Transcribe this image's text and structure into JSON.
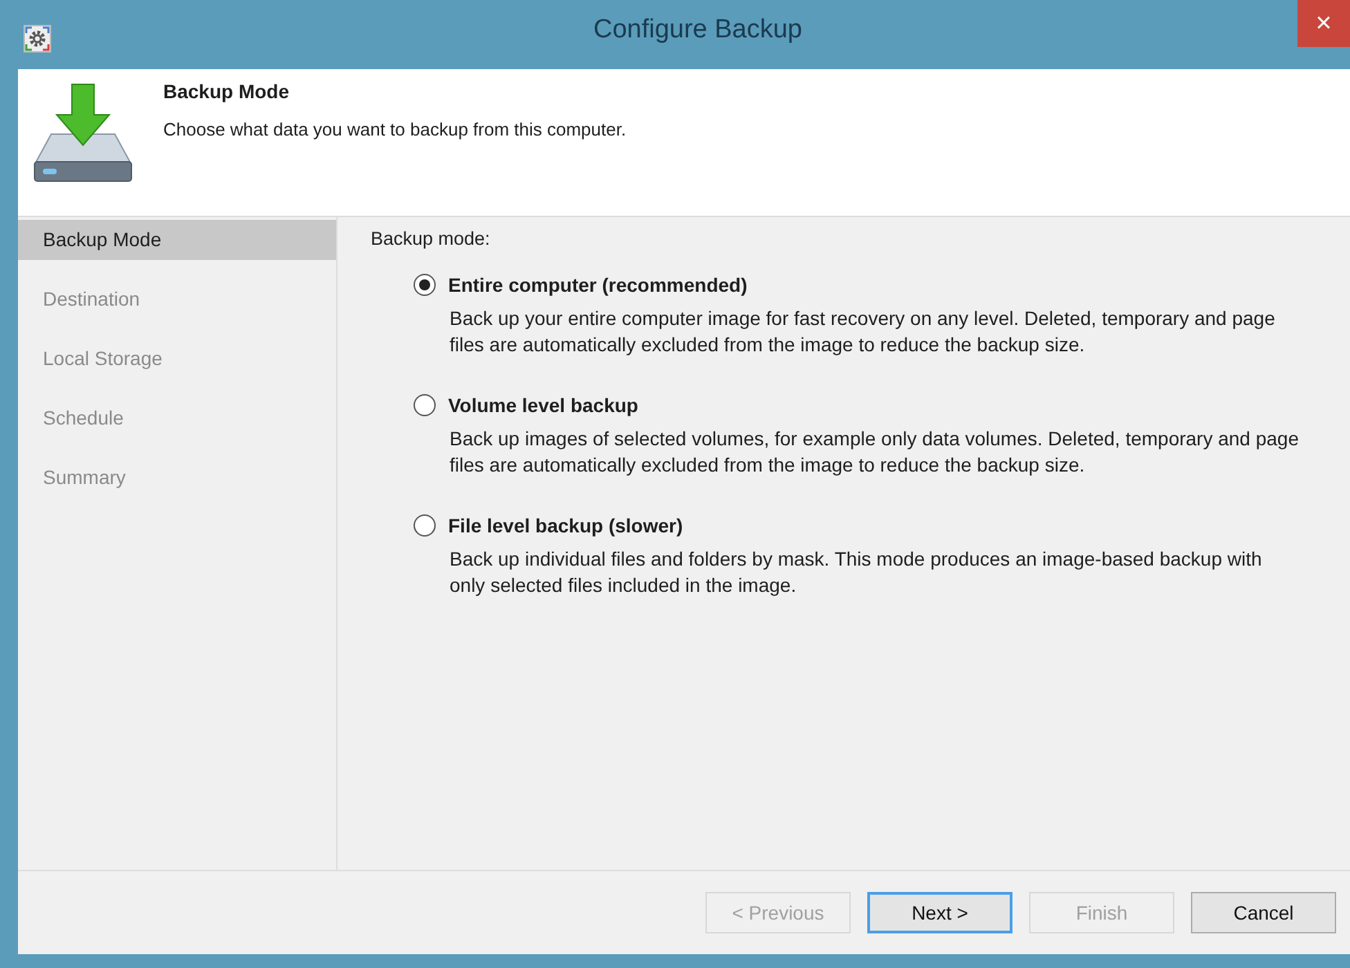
{
  "window": {
    "title": "Configure Backup",
    "close": "×"
  },
  "header": {
    "title": "Backup Mode",
    "subtitle": "Choose what data you want to backup from this computer."
  },
  "steps": [
    {
      "label": "Backup Mode",
      "selected": true
    },
    {
      "label": "Destination",
      "selected": false
    },
    {
      "label": "Local Storage",
      "selected": false
    },
    {
      "label": "Schedule",
      "selected": false
    },
    {
      "label": "Summary",
      "selected": false
    }
  ],
  "content": {
    "label": "Backup mode:",
    "options": [
      {
        "title": "Entire computer (recommended)",
        "description": "Back up your entire computer image for fast recovery on any level. Deleted, temporary and page files are automatically excluded from the image to reduce the backup size.",
        "selected": true
      },
      {
        "title": "Volume level backup",
        "description": "Back up images of selected volumes, for example only data volumes. Deleted, temporary and page files are automatically excluded from the image to reduce the backup size.",
        "selected": false
      },
      {
        "title": "File level backup (slower)",
        "description": "Back up individual files and folders by mask. This mode produces an image-based backup with only selected files included in the image.",
        "selected": false
      }
    ]
  },
  "buttons": [
    {
      "label": "< Previous",
      "disabled": true,
      "focused": false
    },
    {
      "label": "Next >",
      "disabled": false,
      "focused": true
    },
    {
      "label": "Finish",
      "disabled": true,
      "focused": false
    },
    {
      "label": "Cancel",
      "disabled": false,
      "focused": false
    }
  ]
}
